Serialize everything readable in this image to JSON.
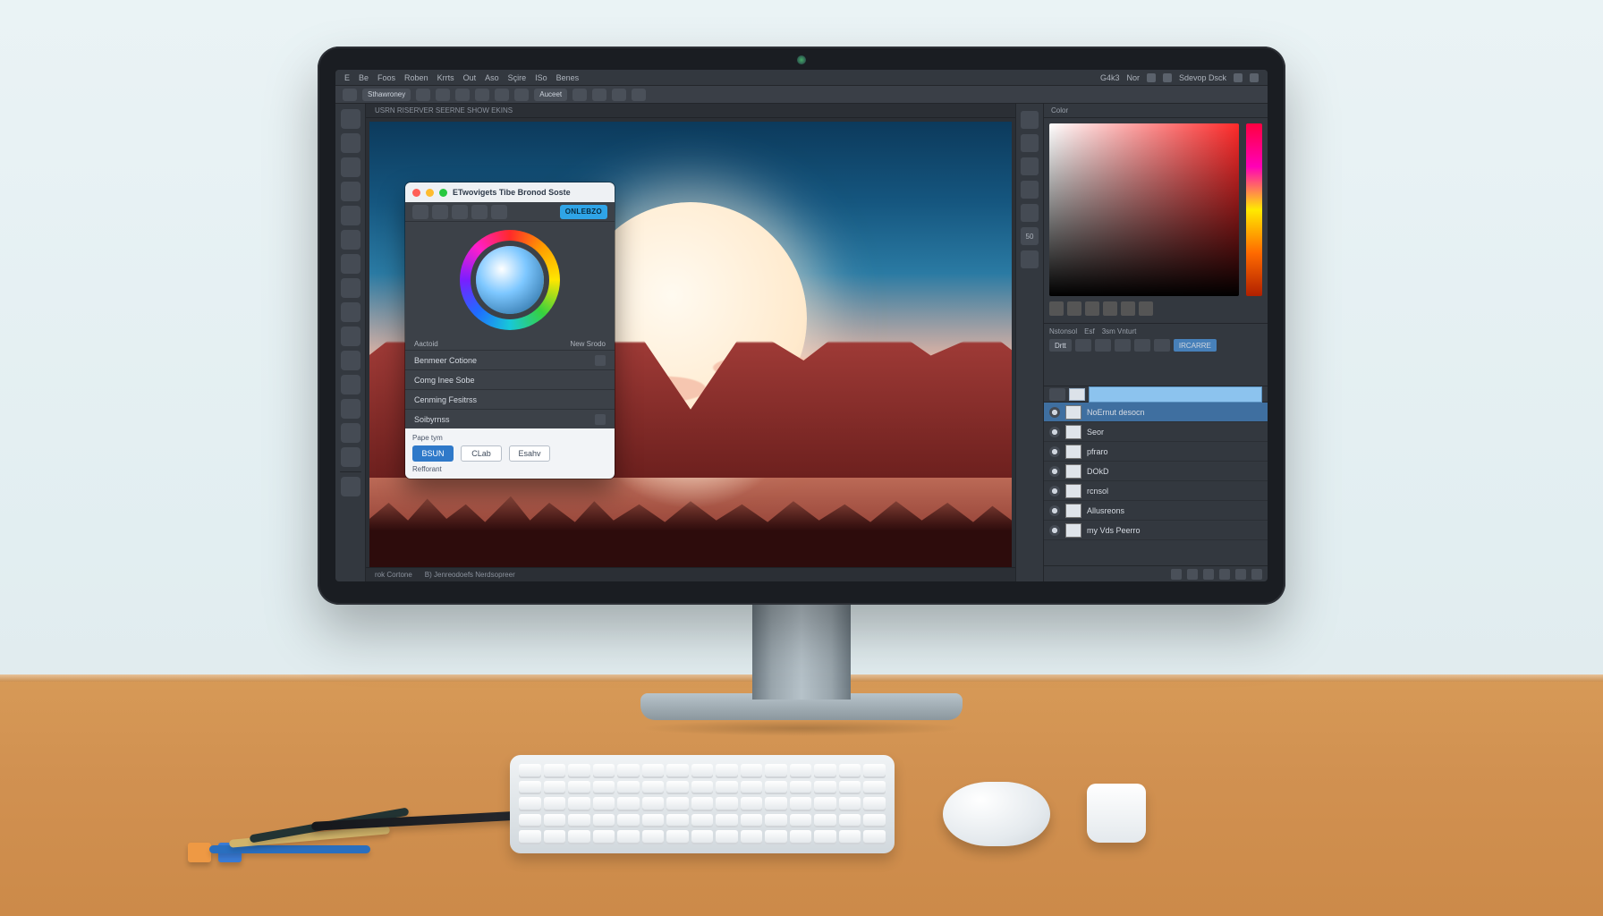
{
  "menu": {
    "app_icon": "E",
    "items": [
      "Be",
      "Foos",
      "Roben",
      "Krrts",
      "Out",
      "Aso",
      "Sçire",
      "ISo",
      "Benes"
    ],
    "right": [
      "G4k3",
      "Nor"
    ],
    "right_label": "Sdevop Dsck"
  },
  "options": {
    "left_groups": [
      "",
      "",
      "",
      "",
      "",
      ""
    ],
    "label_a": "Sthawroney",
    "label_b": "Auceet"
  },
  "tabbar": {
    "doc": "USRN  RISERVER SEERNE SHOW EKINS"
  },
  "statusbar": {
    "left": "rok Cortone",
    "center": "B) Jenreodoefs Nerdsopreer"
  },
  "docks": [
    "",
    "",
    "",
    "",
    "",
    "50",
    ""
  ],
  "panels": {
    "color_tab": "Color",
    "mid_tabs": [
      "Nstonsol",
      "Esf",
      "3sm Vnturt"
    ],
    "mid_label": "Drtt",
    "mid_pill": "IRCARRE"
  },
  "layers": {
    "items": [
      {
        "name": "NoErnut desocn",
        "selected": true
      },
      {
        "name": "Seor"
      },
      {
        "name": "pfraro"
      },
      {
        "name": "DOkD"
      },
      {
        "name": "rcnsol"
      },
      {
        "name": "Allusreons"
      },
      {
        "name": "my Vds Peerro"
      }
    ]
  },
  "dialog": {
    "title": "ETwovigets Tibe Bronod Soste",
    "hex": "ONLEBZO",
    "label_left": "Aactoid",
    "label_right": "New Srodo",
    "list": [
      "Benmeer Cotione",
      "Comg Inee Sobe",
      "Cenming Fesitrss",
      "Soibyrnss"
    ],
    "footer_label": "Pape tym",
    "btn_primary": "BSUN",
    "btn_mid": "CLab",
    "btn_right": "Esahv",
    "footer_sub": "Refforant"
  }
}
